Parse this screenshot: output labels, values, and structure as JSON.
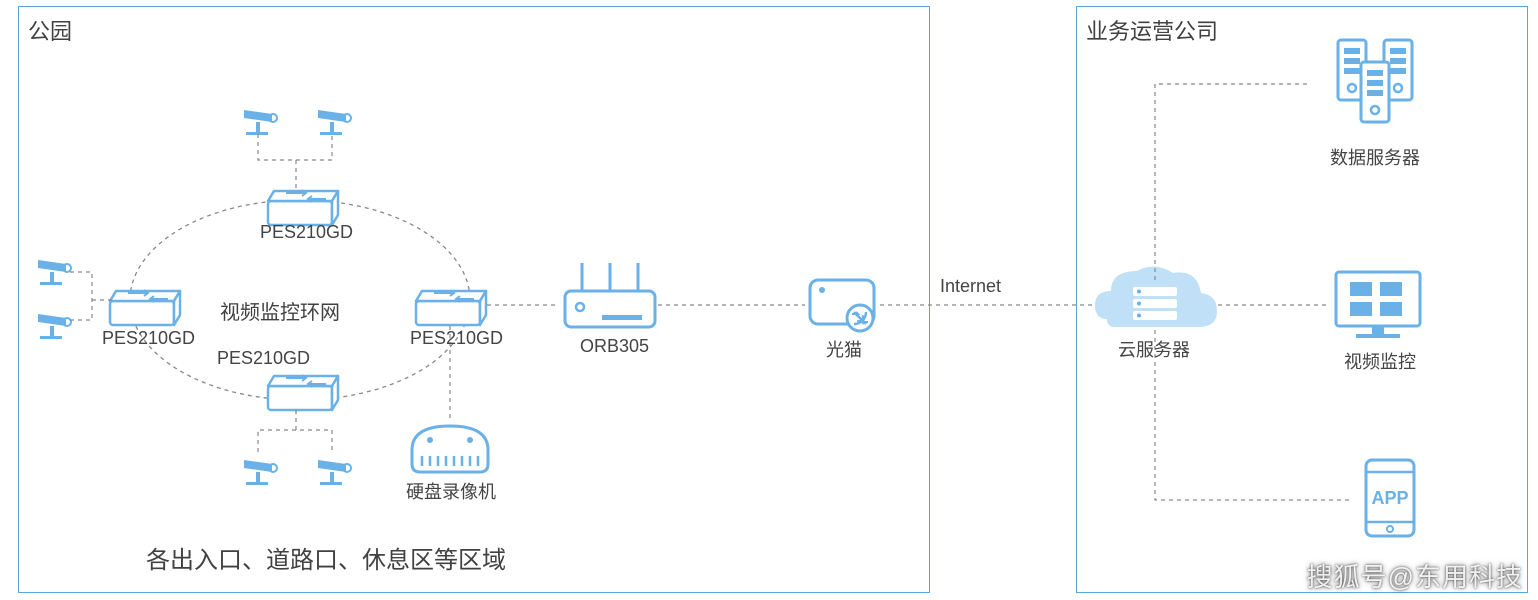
{
  "left_box_title": "公园",
  "right_box_title": "业务运营公司",
  "ring_label": "视频监控环网",
  "switch_label": "PES210GD",
  "router_label": "ORB305",
  "modem_label": "光猫",
  "nvr_label": "硬盘录像机",
  "internet_label": "Internet",
  "cloud_label": "云服务器",
  "data_server_label": "数据服务器",
  "video_monitor_label": "视频监控",
  "app_label": "APP",
  "footer_note": "各出入口、道路口、休息区等区域",
  "watermark": "搜狐号@东用科技",
  "colors": {
    "blue": "#69b1e6",
    "blue2": "#5aa6df",
    "text": "#414141"
  }
}
